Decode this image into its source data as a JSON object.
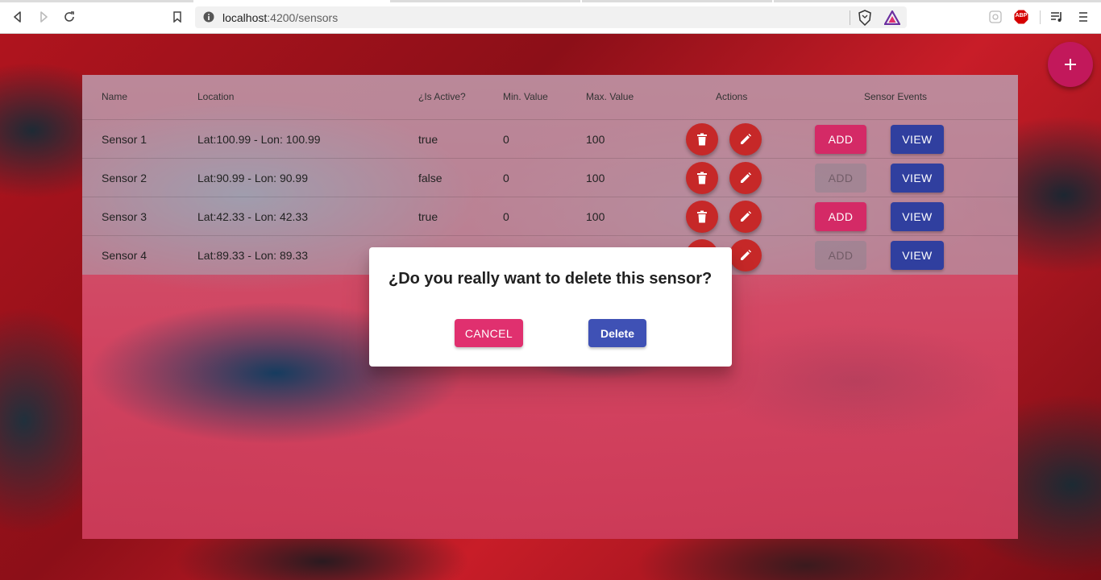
{
  "browser": {
    "url_host": "localhost",
    "url_rest": ":4200/sensors",
    "icons": [
      "back-icon",
      "forward-icon",
      "reload-icon",
      "bookmark-icon",
      "site-info-icon",
      "brave-shield-icon",
      "brave-rewards-icon",
      "extension-icon",
      "adblock-icon",
      "playlist-icon",
      "menu-icon"
    ],
    "adblock_label": "ABP"
  },
  "table": {
    "headers": {
      "name": "Name",
      "location": "Location",
      "active": "¿Is Active?",
      "min": "Min. Value",
      "max": "Max. Value",
      "actions": "Actions",
      "events": "Sensor Events"
    },
    "rows": [
      {
        "name": "Sensor 1",
        "location": "Lat:100.99 - Lon: 100.99",
        "active": "true",
        "min": "0",
        "max": "100",
        "add_label": "ADD",
        "view_label": "VIEW",
        "add_enabled": true
      },
      {
        "name": "Sensor 2",
        "location": "Lat:90.99 - Lon: 90.99",
        "active": "false",
        "min": "0",
        "max": "100",
        "add_label": "ADD",
        "view_label": "VIEW",
        "add_enabled": false
      },
      {
        "name": "Sensor 3",
        "location": "Lat:42.33 - Lon: 42.33",
        "active": "true",
        "min": "0",
        "max": "100",
        "add_label": "ADD",
        "view_label": "VIEW",
        "add_enabled": true
      },
      {
        "name": "Sensor 4",
        "location": "Lat:89.33 - Lon: 89.33",
        "active": "",
        "min": "",
        "max": "",
        "add_label": "ADD",
        "view_label": "VIEW",
        "add_enabled": false
      }
    ]
  },
  "fab": {
    "icon": "plus-icon"
  },
  "dialog": {
    "title": "¿Do you really want to delete this sensor?",
    "cancel_label": "CANCEL",
    "delete_label": "Delete"
  },
  "colors": {
    "add_button": "#d42a66",
    "view_button": "#303f9f",
    "action_fab": "#c62828",
    "main_fab": "#c2185b",
    "cancel_button": "#e0306f",
    "delete_button": "#3f51b5"
  }
}
